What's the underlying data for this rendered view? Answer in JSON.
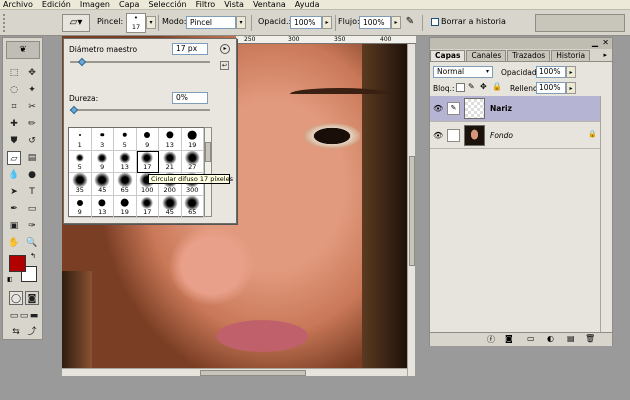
{
  "menu": [
    "Archivo",
    "Edición",
    "Imagen",
    "Capa",
    "Selección",
    "Filtro",
    "Vista",
    "Ventana",
    "Ayuda"
  ],
  "options_bar": {
    "brush_label": "Pincel:",
    "brush_size": "17",
    "mode_label": "Modo:",
    "mode_value": "Pincel",
    "opacity_label": "Opacid.:",
    "opacity_value": "100%",
    "flow_label": "Flujo:",
    "flow_value": "100%",
    "erase_history_label": "Borrar a historia"
  },
  "brush_popup": {
    "master_diameter_label": "Diámetro maestro",
    "master_diameter_value": "17 px",
    "hardness_label": "Dureza:",
    "hardness_value": "0%",
    "brushes": [
      {
        "size": "1",
        "type": "hard"
      },
      {
        "size": "3",
        "type": "hard"
      },
      {
        "size": "5",
        "type": "hard"
      },
      {
        "size": "9",
        "type": "hard"
      },
      {
        "size": "13",
        "type": "hard"
      },
      {
        "size": "19",
        "type": "hard"
      },
      {
        "size": "5",
        "type": "soft"
      },
      {
        "size": "9",
        "type": "soft"
      },
      {
        "size": "13",
        "type": "soft"
      },
      {
        "size": "17",
        "type": "soft"
      },
      {
        "size": "21",
        "type": "soft"
      },
      {
        "size": "27",
        "type": "soft"
      },
      {
        "size": "35",
        "type": "soft"
      },
      {
        "size": "45",
        "type": "soft"
      },
      {
        "size": "65",
        "type": "soft"
      },
      {
        "size": "100",
        "type": "soft"
      },
      {
        "size": "200",
        "type": "soft"
      },
      {
        "size": "300",
        "type": "soft"
      },
      {
        "size": "9",
        "type": "hard"
      },
      {
        "size": "13",
        "type": "hard"
      },
      {
        "size": "19",
        "type": "hard"
      },
      {
        "size": "17",
        "type": "soft"
      },
      {
        "size": "45",
        "type": "soft"
      },
      {
        "size": "65",
        "type": "soft"
      }
    ],
    "selected_index": 9,
    "tooltip": "Circular difuso 17 píxeles"
  },
  "ruler_ticks": [
    "250",
    "300",
    "350",
    "400"
  ],
  "layers_panel": {
    "tabs": [
      "Capas",
      "Canales",
      "Trazados",
      "Historia"
    ],
    "blend_mode": "Normal",
    "opacity_label": "Opacidad:",
    "opacity_value": "100%",
    "lock_label": "Bloq.:",
    "fill_label": "Relleno:",
    "fill_value": "100%",
    "layers": [
      {
        "name": "Nariz",
        "selected": true
      },
      {
        "name": "Fondo",
        "selected": false
      }
    ]
  },
  "colors": {
    "foreground": "#b00000",
    "background": "#ffffff",
    "accent": "#0a246a"
  }
}
